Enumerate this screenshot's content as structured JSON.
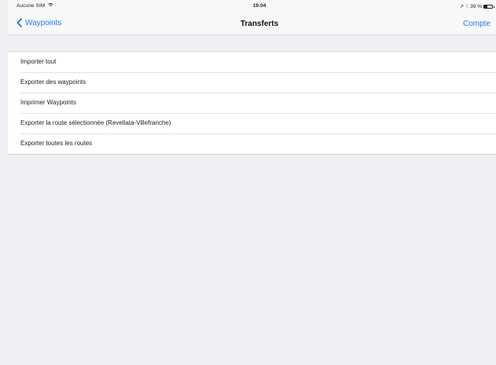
{
  "status_bar": {
    "carrier": "Aucune SIM",
    "time": "19:04",
    "location_glyph": "➚",
    "bluetooth_glyph": "ᛒ",
    "battery_percent_text": "39 %",
    "battery_level": 0.39
  },
  "nav": {
    "back_label": "Waypoints",
    "title": "Transferts",
    "right_label": "Compte"
  },
  "list": {
    "items": [
      {
        "label": "Importer tout"
      },
      {
        "label": "Exporter des waypoints"
      },
      {
        "label": "Imprimer Waypoints"
      },
      {
        "label": "Exporter la route sélectionnée (Revellata-Villefranche)"
      },
      {
        "label": "Exporter toutes les routes"
      }
    ]
  },
  "colors": {
    "accent": "#1a7cf6",
    "background": "#efeff4",
    "cell": "#ffffff",
    "separator": "#d6d6d9"
  }
}
